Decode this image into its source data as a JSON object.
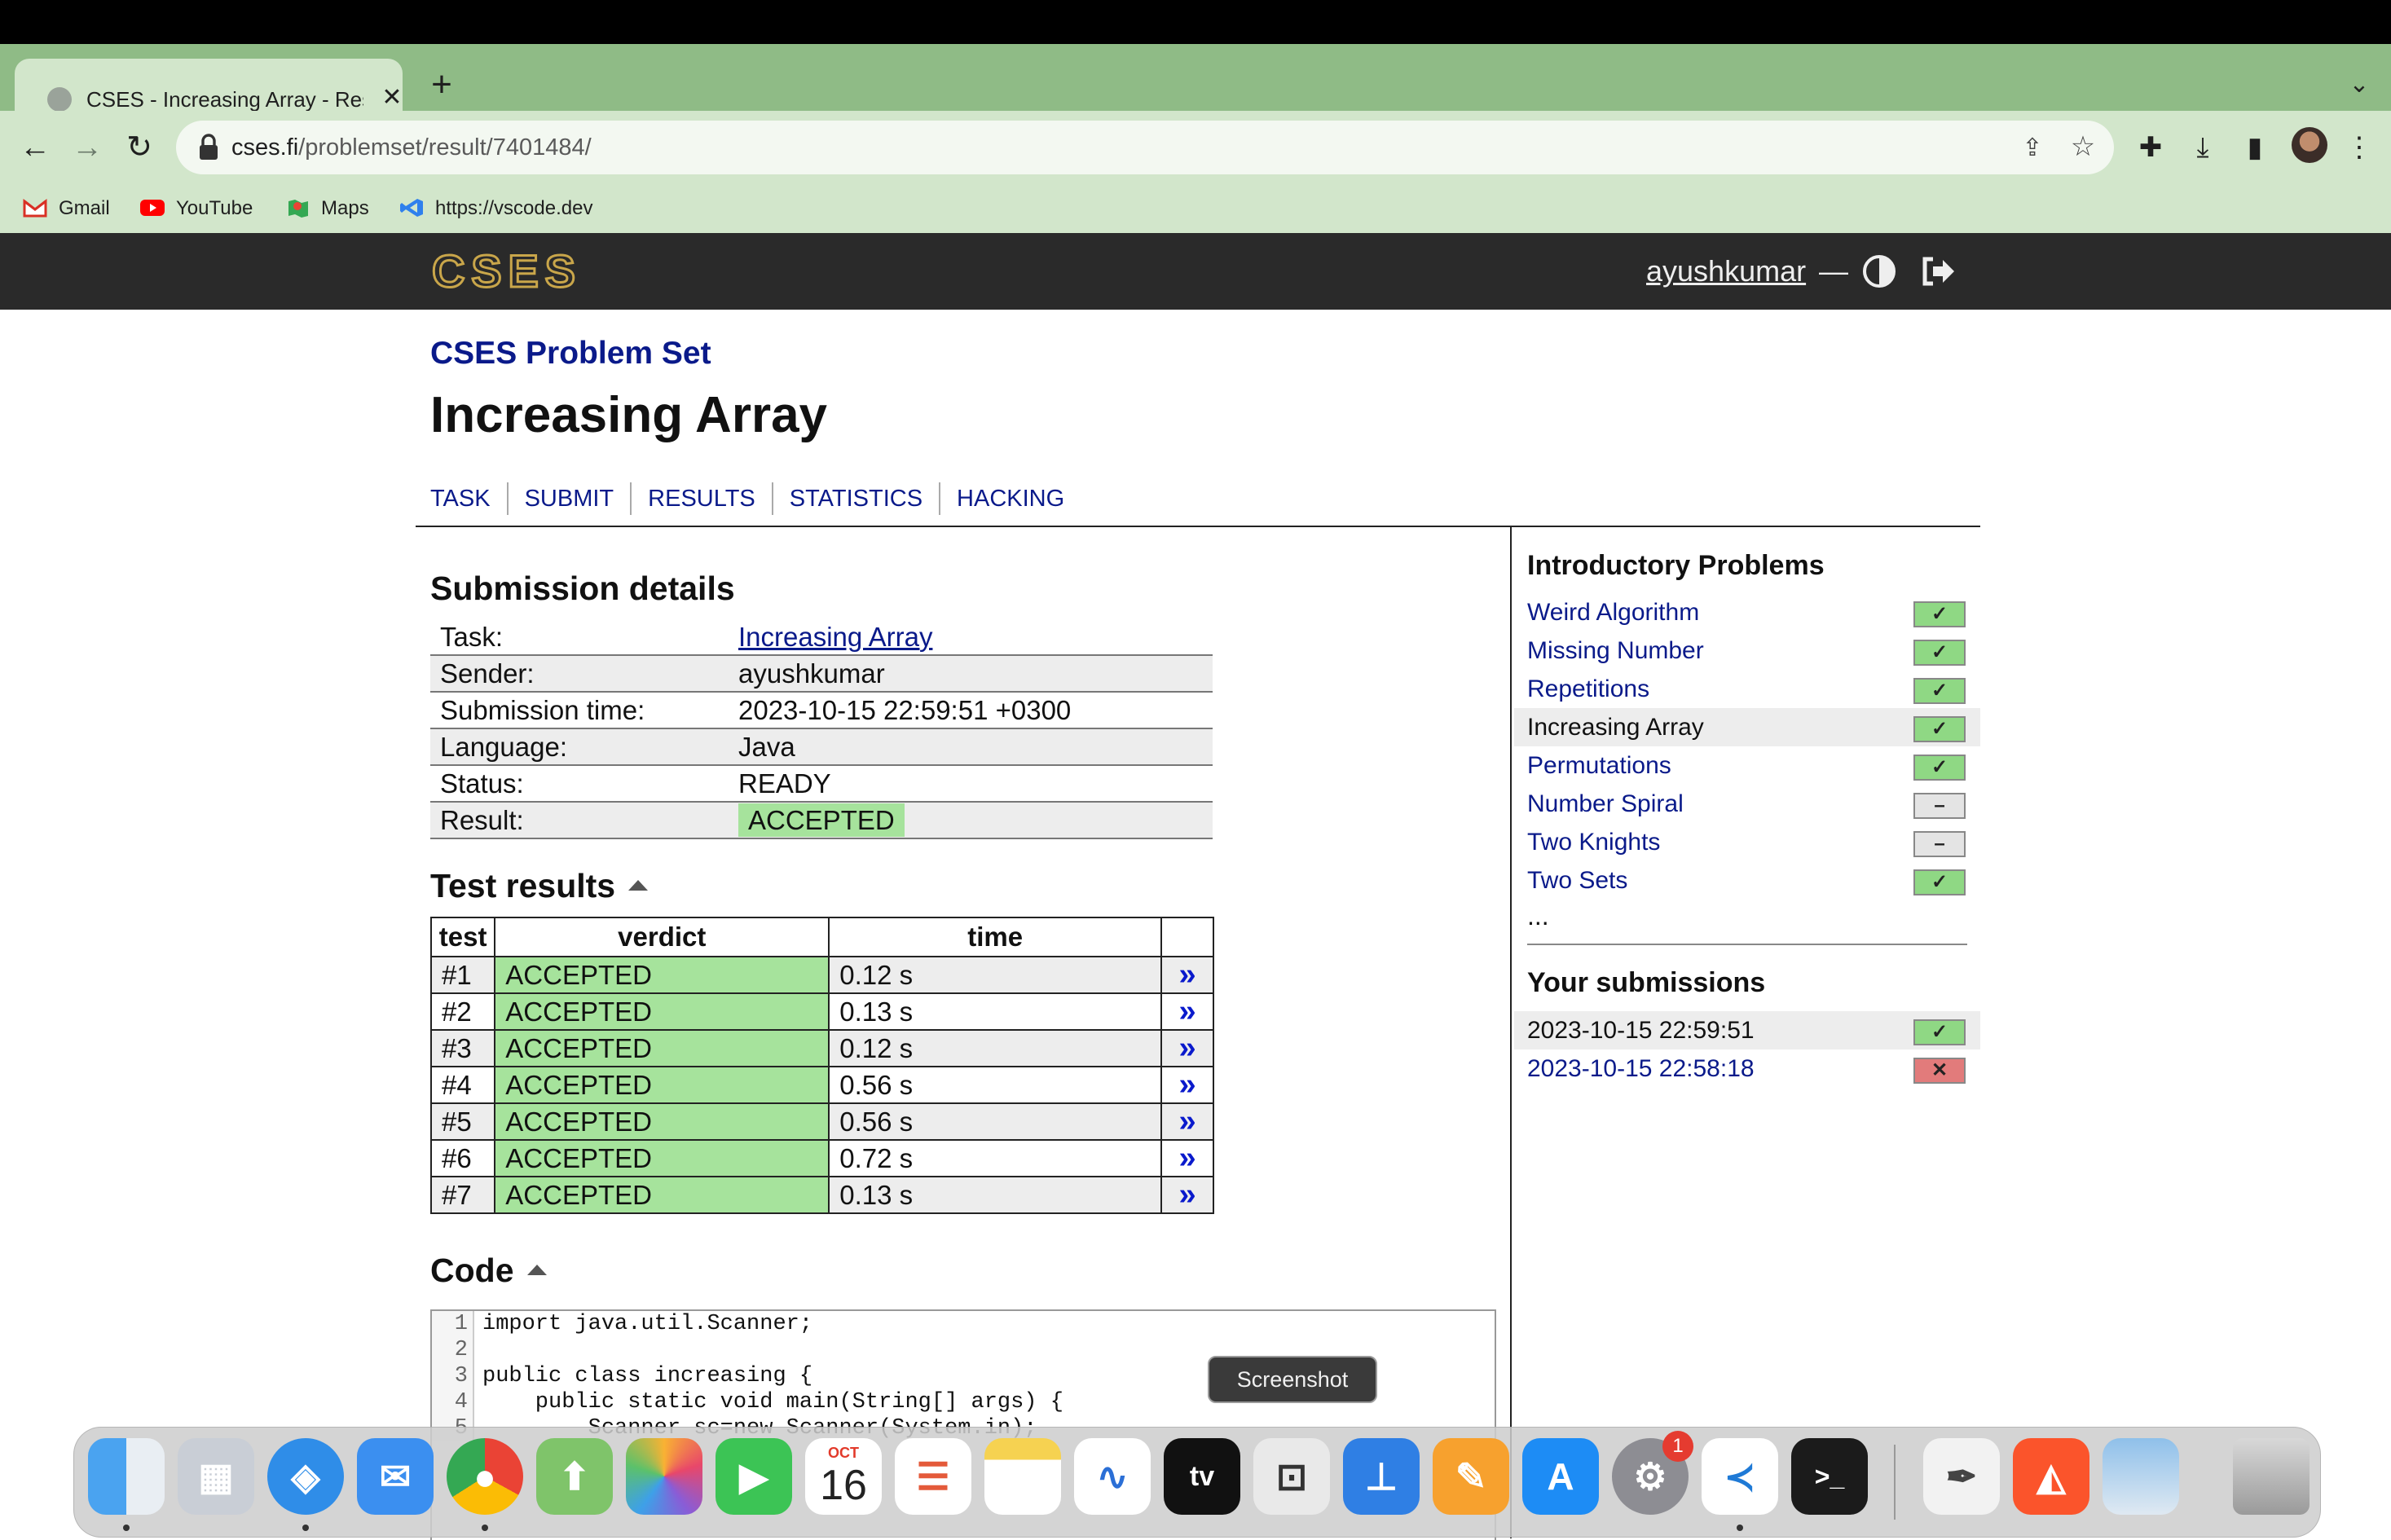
{
  "browser": {
    "tab_title": "CSES - Increasing Array - Result",
    "tab_close": "✕",
    "new_tab": "+",
    "tab_list": "⌄",
    "url_host": "cses.fi",
    "url_path": "/problemset/result/7401484/",
    "bookmarks": [
      {
        "label": "Gmail",
        "icon": "gmail-icon",
        "color": "#d93025"
      },
      {
        "label": "YouTube",
        "icon": "youtube-icon",
        "color": "#ff0000"
      },
      {
        "label": "Maps",
        "icon": "maps-icon",
        "color": "#34a853"
      },
      {
        "label": "https://vscode.dev",
        "icon": "vscode-icon",
        "color": "#2f80ed"
      }
    ]
  },
  "site": {
    "logo_text": "CSES",
    "username": "ayushkumar",
    "dash": "—"
  },
  "page": {
    "breadcrumb": "CSES Problem Set",
    "title": "Increasing Array",
    "nav": [
      "TASK",
      "SUBMIT",
      "RESULTS",
      "STATISTICS",
      "HACKING"
    ]
  },
  "submission": {
    "heading": "Submission details",
    "rows": [
      {
        "label": "Task:",
        "value": "Increasing Array"
      },
      {
        "label": "Sender:",
        "value": "ayushkumar"
      },
      {
        "label": "Submission time:",
        "value": "2023-10-15 22:59:51 +0300"
      },
      {
        "label": "Language:",
        "value": "Java"
      },
      {
        "label": "Status:",
        "value": "READY"
      },
      {
        "label": "Result:",
        "value": "ACCEPTED"
      }
    ]
  },
  "tests": {
    "heading": "Test results",
    "headers": [
      "test",
      "verdict",
      "time"
    ],
    "rows": [
      {
        "test": "#1",
        "verdict": "ACCEPTED",
        "time": "0.12 s"
      },
      {
        "test": "#2",
        "verdict": "ACCEPTED",
        "time": "0.13 s"
      },
      {
        "test": "#3",
        "verdict": "ACCEPTED",
        "time": "0.12 s"
      },
      {
        "test": "#4",
        "verdict": "ACCEPTED",
        "time": "0.56 s"
      },
      {
        "test": "#5",
        "verdict": "ACCEPTED",
        "time": "0.56 s"
      },
      {
        "test": "#6",
        "verdict": "ACCEPTED",
        "time": "0.72 s"
      },
      {
        "test": "#7",
        "verdict": "ACCEPTED",
        "time": "0.13 s"
      }
    ],
    "arrow": "»"
  },
  "code": {
    "heading": "Code",
    "lines": [
      {
        "n": "1",
        "text": "import java.util.Scanner;"
      },
      {
        "n": "2",
        "text": ""
      },
      {
        "n": "3",
        "text": "public class increasing {"
      },
      {
        "n": "4",
        "text": "    public static void main(String[] args) {"
      },
      {
        "n": "5",
        "text": "        Scanner sc=new Scanner(System.in);"
      }
    ]
  },
  "sidebar": {
    "heading": "Introductory Problems",
    "problems": [
      {
        "label": "Weird Algorithm",
        "status": "✓",
        "state": "ok"
      },
      {
        "label": "Missing Number",
        "status": "✓",
        "state": "ok"
      },
      {
        "label": "Repetitions",
        "status": "✓",
        "state": "ok"
      },
      {
        "label": "Increasing Array",
        "status": "✓",
        "state": "ok"
      },
      {
        "label": "Permutations",
        "status": "✓",
        "state": "ok"
      },
      {
        "label": "Number Spiral",
        "status": "–",
        "state": "none"
      },
      {
        "label": "Two Knights",
        "status": "–",
        "state": "none"
      },
      {
        "label": "Two Sets",
        "status": "✓",
        "state": "ok"
      }
    ],
    "ellipsis": "...",
    "submissions_heading": "Your submissions",
    "submissions": [
      {
        "label": "2023-10-15 22:59:51",
        "status": "✓",
        "state": "ok"
      },
      {
        "label": "2023-10-15 22:58:18",
        "status": "✕",
        "state": "bad"
      }
    ]
  },
  "tooltip": "Screenshot",
  "dock": {
    "calendar_month": "OCT",
    "calendar_day": "16",
    "notification_count": "1"
  }
}
